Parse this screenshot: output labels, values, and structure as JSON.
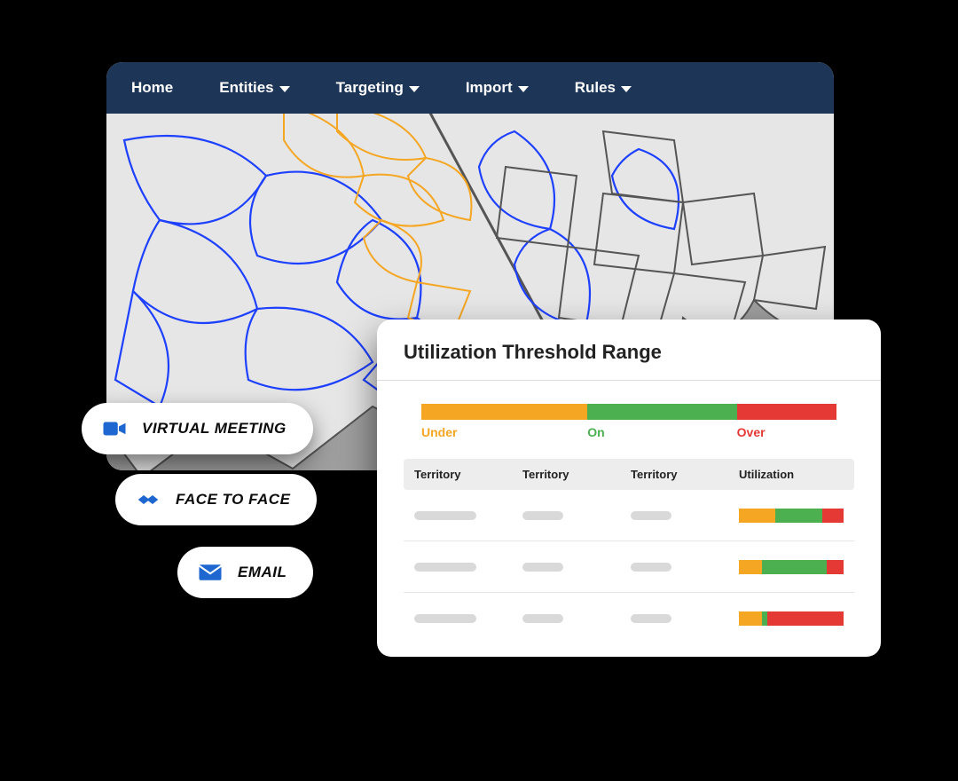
{
  "nav": {
    "home": "Home",
    "entities": "Entities",
    "targeting": "Targeting",
    "import": "Import",
    "rules": "Rules"
  },
  "channels": {
    "virtual": "VIRTUAL MEETING",
    "face_to_face": "FACE TO FACE",
    "email": "EMAIL"
  },
  "util": {
    "title": "Utilization Threshold Range",
    "range": {
      "under": "Under",
      "on": "On",
      "over": "Over"
    },
    "columns": {
      "territory": "Territory",
      "utilization": "Utilization"
    },
    "colors": {
      "under": "#f5a623",
      "on": "#4caf50",
      "over": "#e53935"
    },
    "rows": [
      {
        "under": 35,
        "on": 45,
        "over": 20
      },
      {
        "under": 22,
        "on": 62,
        "over": 16
      },
      {
        "under": 22,
        "on": 5,
        "over": 73
      }
    ]
  }
}
